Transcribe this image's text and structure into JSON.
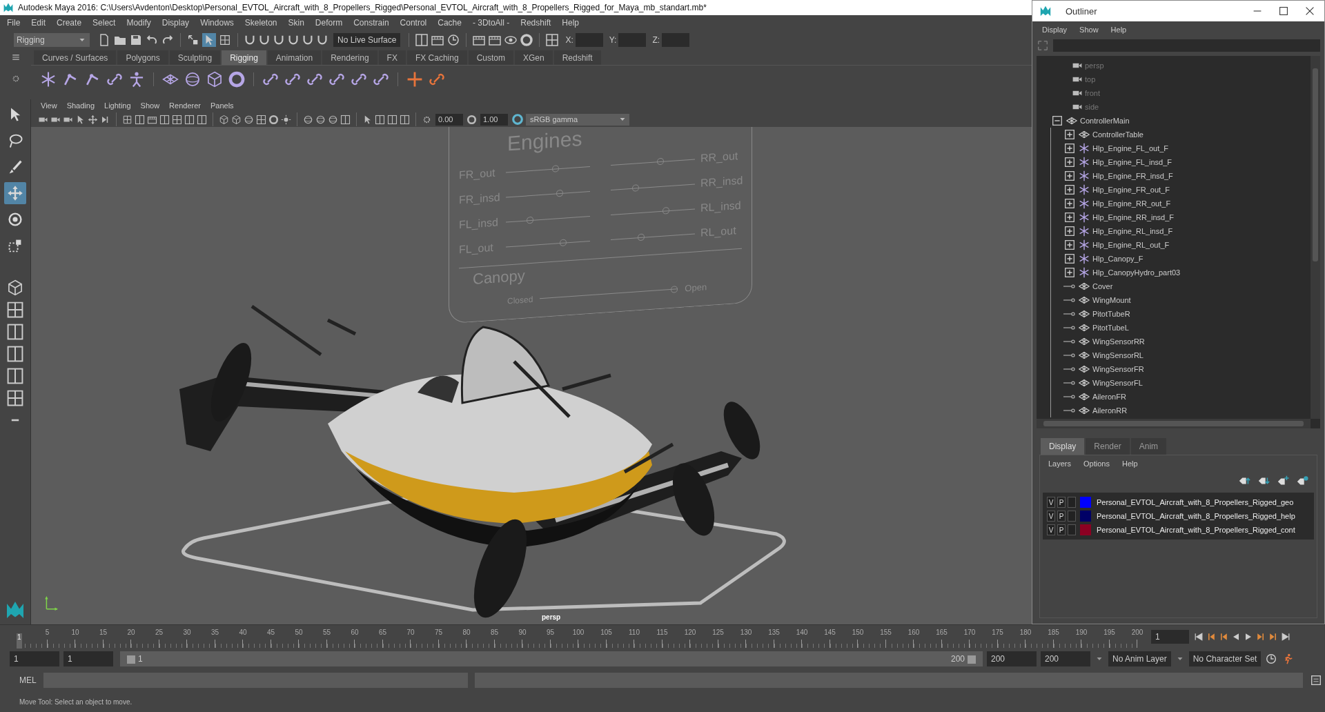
{
  "window": {
    "title": "Autodesk Maya 2016: C:\\Users\\Avdenton\\Desktop\\Personal_EVTOL_Aircraft_with_8_Propellers_Rigged\\Personal_EVTOL_Aircraft_with_8_Propellers_Rigged_for_Maya_mb_standart.mb*"
  },
  "menu_bar": [
    "File",
    "Edit",
    "Create",
    "Select",
    "Modify",
    "Display",
    "Windows",
    "Skeleton",
    "Skin",
    "Deform",
    "Constrain",
    "Control",
    "Cache",
    "- 3DtoAll -",
    "Redshift",
    "Help"
  ],
  "status_line": {
    "mode": "Rigging",
    "live_surface": "No Live Surface",
    "selection_modes": [
      {
        "kind": "hierarchy",
        "selected": false
      },
      {
        "kind": "object",
        "selected": true
      },
      {
        "kind": "component",
        "selected": false
      }
    ],
    "coords": [
      "X:",
      "Y:",
      "Z:"
    ]
  },
  "shelf": {
    "tabs": [
      {
        "label": "Curves / Surfaces",
        "selected": false
      },
      {
        "label": "Polygons",
        "selected": false
      },
      {
        "label": "Sculpting",
        "selected": false
      },
      {
        "label": "Rigging",
        "selected": true
      },
      {
        "label": "Animation",
        "selected": false
      },
      {
        "label": "Rendering",
        "selected": false
      },
      {
        "label": "FX",
        "selected": false
      },
      {
        "label": "FX Caching",
        "selected": false
      },
      {
        "label": "Custom",
        "selected": false
      },
      {
        "label": "XGen",
        "selected": false
      },
      {
        "label": "Redshift",
        "selected": false
      }
    ]
  },
  "toolbox": {
    "tools": [
      {
        "kind": "select",
        "selected": false
      },
      {
        "kind": "lasso",
        "selected": false
      },
      {
        "kind": "paint",
        "selected": false
      },
      {
        "kind": "move",
        "selected": true
      },
      {
        "kind": "rotate",
        "selected": false
      },
      {
        "kind": "scale",
        "selected": false
      }
    ]
  },
  "viewport": {
    "menu": [
      "View",
      "Shading",
      "Lighting",
      "Show",
      "Renderer",
      "Panels"
    ],
    "exposure": "0.00",
    "gamma": "1.00",
    "color_space": "sRGB gamma",
    "camera_label": "persp",
    "controller": {
      "title": "Engines",
      "left_sliders": [
        {
          "label": "FR_out",
          "level": 0.6
        },
        {
          "label": "FR_insd",
          "level": 0.65
        },
        {
          "label": "FL_insd",
          "level": 0.27
        },
        {
          "label": "FL_out",
          "level": 0.7
        }
      ],
      "right_sliders": [
        {
          "label": "RR_out",
          "level": 0.6
        },
        {
          "label": "RR_insd",
          "level": 0.28
        },
        {
          "label": "RL_insd",
          "level": 0.67
        },
        {
          "label": "RL_out",
          "level": 0.35
        }
      ],
      "canopy": {
        "title": "Canopy",
        "min_label": "Closed",
        "max_label": "Open",
        "level": 1
      }
    }
  },
  "timeline": {
    "start_frame": "1",
    "ticks": [
      "5",
      "10",
      "15",
      "20",
      "25",
      "30",
      "35",
      "40",
      "45",
      "50",
      "55",
      "60",
      "65",
      "70",
      "75",
      "80",
      "85",
      "90",
      "95",
      "100",
      "105",
      "110",
      "115",
      "120",
      "125",
      "130",
      "135",
      "140",
      "145",
      "150",
      "155",
      "160",
      "165",
      "170",
      "175",
      "180",
      "185",
      "190",
      "195",
      "200"
    ],
    "current_frame": "1",
    "level": 0
  },
  "range": {
    "start": "1",
    "playback_start": "1",
    "slider_start": "1",
    "slider_end": "200",
    "playback_end": "200",
    "end": "200",
    "level": 1,
    "anim_layer": "No Anim Layer",
    "character_set": "No Character Set"
  },
  "command_line": {
    "label": "MEL"
  },
  "help_line": "Move Tool: Select an object to move.",
  "outliner": {
    "title": "Outliner",
    "menu": [
      "Display",
      "Show",
      "Help"
    ],
    "tree": [
      {
        "label": "persp",
        "kind": "camera"
      },
      {
        "label": "top",
        "kind": "camera"
      },
      {
        "label": "front",
        "kind": "camera"
      },
      {
        "label": "side",
        "kind": "camera"
      },
      {
        "label": "ControllerMain",
        "kind": "transform",
        "expanded": true,
        "children": [
          {
            "label": "ControllerTable",
            "kind": "transform",
            "expanded": false
          },
          {
            "label": "Hlp_Engine_FL_out_F",
            "kind": "helper",
            "expanded": false
          },
          {
            "label": "Hlp_Engine_FL_insd_F",
            "kind": "helper",
            "expanded": false
          },
          {
            "label": "Hlp_Engine_FR_insd_F",
            "kind": "helper",
            "expanded": false
          },
          {
            "label": "Hlp_Engine_FR_out_F",
            "kind": "helper",
            "expanded": false
          },
          {
            "label": "Hlp_Engine_RR_out_F",
            "kind": "helper",
            "expanded": false
          },
          {
            "label": "Hlp_Engine_RR_insd_F",
            "kind": "helper",
            "expanded": false
          },
          {
            "label": "Hlp_Engine_RL_insd_F",
            "kind": "helper",
            "expanded": false
          },
          {
            "label": "Hlp_Engine_RL_out_F",
            "kind": "helper",
            "expanded": false
          },
          {
            "label": "Hlp_Canopy_F",
            "kind": "helper",
            "expanded": false
          },
          {
            "label": "Hlp_CanopyHydro_part03",
            "kind": "helper",
            "expanded": false
          },
          {
            "label": "Cover",
            "kind": "transform"
          },
          {
            "label": "WingMount",
            "kind": "transform"
          },
          {
            "label": "PitotTubeR",
            "kind": "transform"
          },
          {
            "label": "PitotTubeL",
            "kind": "transform"
          },
          {
            "label": "WingSensorRR",
            "kind": "transform"
          },
          {
            "label": "WingSensorRL",
            "kind": "transform"
          },
          {
            "label": "WingSensorFR",
            "kind": "transform"
          },
          {
            "label": "WingSensorFL",
            "kind": "transform"
          },
          {
            "label": "AileronFR",
            "kind": "transform"
          },
          {
            "label": "AileronRR",
            "kind": "transform"
          }
        ]
      }
    ]
  },
  "layer_editor": {
    "tabs": [
      {
        "label": "Display",
        "selected": true
      },
      {
        "label": "Render",
        "selected": false
      },
      {
        "label": "Anim",
        "selected": false
      }
    ],
    "menu": [
      "Layers",
      "Options",
      "Help"
    ],
    "layers": [
      {
        "visible": "V",
        "playback": "P",
        "color": "#0000ff",
        "name": "Personal_EVTOL_Aircraft_with_8_Propellers_Rigged_geo"
      },
      {
        "visible": "V",
        "playback": "P",
        "color": "#000066",
        "name": "Personal_EVTOL_Aircraft_with_8_Propellers_Rigged_help"
      },
      {
        "visible": "V",
        "playback": "P",
        "color": "#8c0022",
        "name": "Personal_EVTOL_Aircraft_with_8_Propellers_Rigged_cont"
      }
    ]
  }
}
